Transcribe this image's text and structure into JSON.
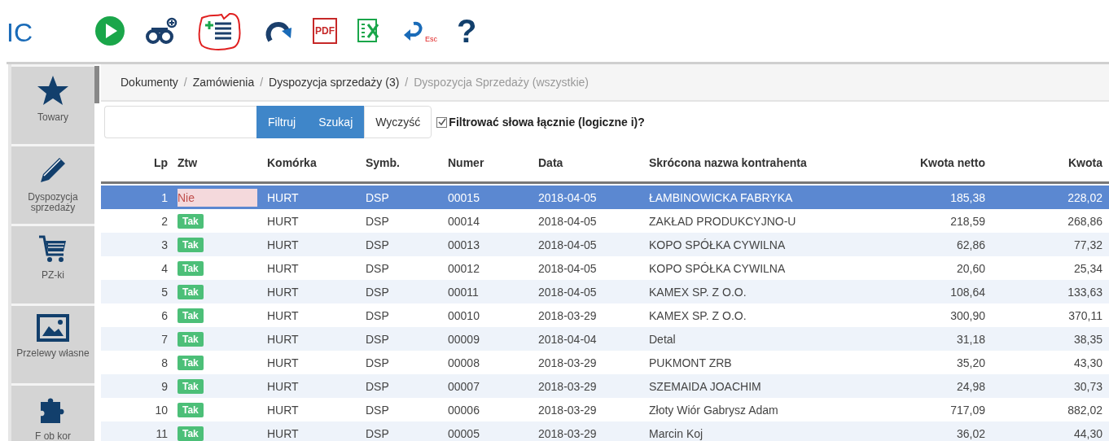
{
  "logo": {
    "text": "IC"
  },
  "toolbar": {
    "help": "?",
    "esc_label": "Esc",
    "pdf_label": "PDF"
  },
  "sidebar": {
    "items": [
      {
        "label": "Towary"
      },
      {
        "label": "Dyspozycja sprzedaży"
      },
      {
        "label": "PZ-ki"
      },
      {
        "label": "Przelewy własne"
      },
      {
        "label": "F ob kor"
      }
    ]
  },
  "breadcrumb": {
    "separator": "/",
    "items": [
      {
        "label": "Dokumenty",
        "active": false
      },
      {
        "label": "Zamówienia",
        "active": false
      },
      {
        "label": "Dyspozycja sprzedaży (3)",
        "active": false
      },
      {
        "label": "Dyspozycja Sprzedaży (wszystkie)",
        "active": true
      }
    ]
  },
  "filter": {
    "buttons": [
      {
        "label": "Filtruj",
        "primary": true
      },
      {
        "label": "Szukaj",
        "primary": true
      },
      {
        "label": "Wyczyść",
        "primary": false
      }
    ],
    "checkbox": {
      "label": "Filtrować słowa łącznie (logiczne i)?",
      "checked": true
    }
  },
  "table": {
    "columns": [
      "Lp",
      "Ztw",
      "Komórka",
      "Symb.",
      "Numer",
      "Data",
      "Skrócona nazwa kontrahenta",
      "Kwota netto",
      "Kwota"
    ],
    "rows": [
      {
        "lp": "1",
        "ztw": {
          "label": "Nie",
          "confirmed": false
        },
        "cell": "HURT",
        "symb": "DSP",
        "number": "00015",
        "date": "2018-04-05",
        "name": "ŁAMBINOWICKA FABRYKA",
        "net": "185,38",
        "gross": "228,02",
        "selected": true
      },
      {
        "lp": "2",
        "ztw": {
          "label": "Tak",
          "confirmed": true
        },
        "cell": "HURT",
        "symb": "DSP",
        "number": "00014",
        "date": "2018-04-05",
        "name": "ZAKŁAD PRODUKCYJNO-U",
        "net": "218,59",
        "gross": "268,86",
        "selected": false
      },
      {
        "lp": "3",
        "ztw": {
          "label": "Tak",
          "confirmed": true
        },
        "cell": "HURT",
        "symb": "DSP",
        "number": "00013",
        "date": "2018-04-05",
        "name": "KOPO SPÓŁKA CYWILNA",
        "net": "62,86",
        "gross": "77,32",
        "selected": false
      },
      {
        "lp": "4",
        "ztw": {
          "label": "Tak",
          "confirmed": true
        },
        "cell": "HURT",
        "symb": "DSP",
        "number": "00012",
        "date": "2018-04-05",
        "name": "KOPO SPÓŁKA CYWILNA",
        "net": "20,60",
        "gross": "25,34",
        "selected": false
      },
      {
        "lp": "5",
        "ztw": {
          "label": "Tak",
          "confirmed": true
        },
        "cell": "HURT",
        "symb": "DSP",
        "number": "00011",
        "date": "2018-04-05",
        "name": "KAMEX SP. Z O.O.",
        "net": "108,64",
        "gross": "133,63",
        "selected": false
      },
      {
        "lp": "6",
        "ztw": {
          "label": "Tak",
          "confirmed": true
        },
        "cell": "HURT",
        "symb": "DSP",
        "number": "00010",
        "date": "2018-03-29",
        "name": "KAMEX SP. Z O.O.",
        "net": "300,90",
        "gross": "370,11",
        "selected": false
      },
      {
        "lp": "7",
        "ztw": {
          "label": "Tak",
          "confirmed": true
        },
        "cell": "HURT",
        "symb": "DSP",
        "number": "00009",
        "date": "2018-04-04",
        "name": "Detal",
        "net": "31,18",
        "gross": "38,35",
        "selected": false
      },
      {
        "lp": "8",
        "ztw": {
          "label": "Tak",
          "confirmed": true
        },
        "cell": "HURT",
        "symb": "DSP",
        "number": "00008",
        "date": "2018-03-29",
        "name": "PUKMONT ZRB",
        "net": "35,20",
        "gross": "43,30",
        "selected": false
      },
      {
        "lp": "9",
        "ztw": {
          "label": "Tak",
          "confirmed": true
        },
        "cell": "HURT",
        "symb": "DSP",
        "number": "00007",
        "date": "2018-03-29",
        "name": "SZEMAIDA JOACHIM",
        "net": "24,98",
        "gross": "30,73",
        "selected": false
      },
      {
        "lp": "10",
        "ztw": {
          "label": "Tak",
          "confirmed": true
        },
        "cell": "HURT",
        "symb": "DSP",
        "number": "00006",
        "date": "2018-03-29",
        "name": "Złoty Wiór Gabrysz Adam",
        "net": "717,09",
        "gross": "882,02",
        "selected": false
      },
      {
        "lp": "11",
        "ztw": {
          "label": "Tak",
          "confirmed": true
        },
        "cell": "HURT",
        "symb": "DSP",
        "number": "00005",
        "date": "2018-03-29",
        "name": "Marcin Koj",
        "net": "36,02",
        "gross": "44,30",
        "selected": false
      }
    ]
  }
}
